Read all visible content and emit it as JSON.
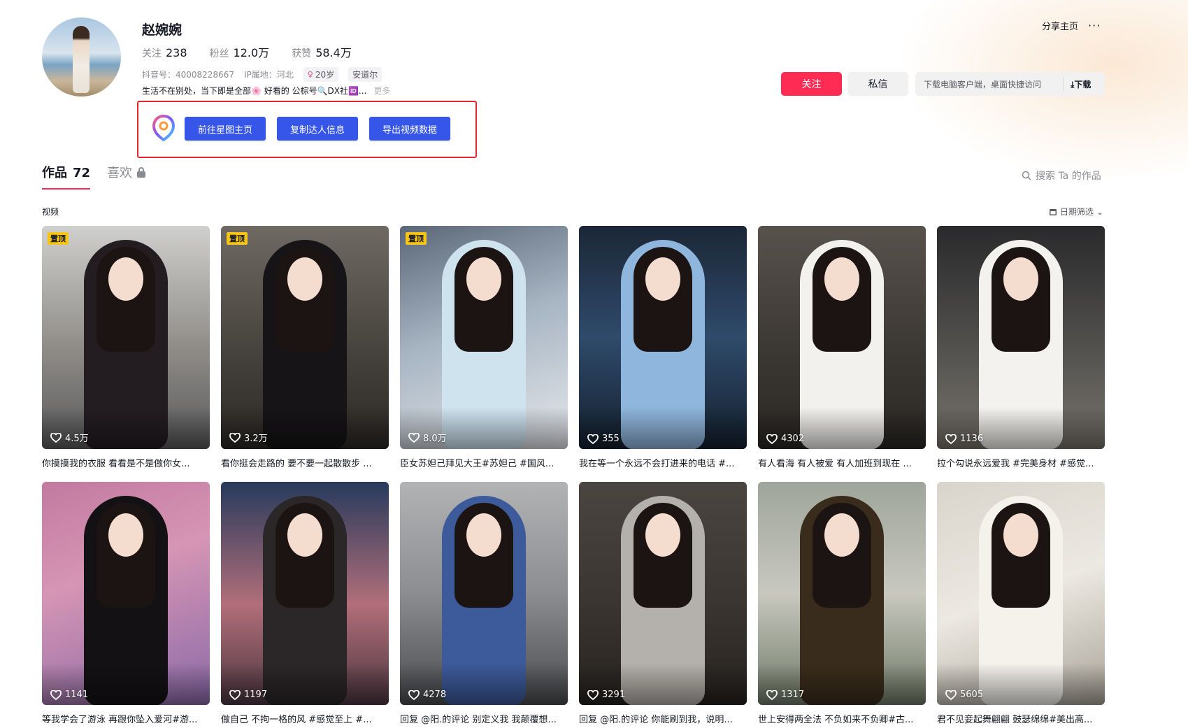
{
  "profile": {
    "name": "赵婉婉",
    "stats": [
      {
        "label": "关注",
        "value": "238"
      },
      {
        "label": "粉丝",
        "value": "12.0万"
      },
      {
        "label": "获赞",
        "value": "58.4万"
      }
    ],
    "douyin_id": "抖音号：40008228667",
    "ip": "IP属地：河北",
    "age": "20岁",
    "location": "安道尔",
    "bio": "生活不在别处，当下即是全部🌸 好看的 公棕号🔍DX社🆔...",
    "more": "更多"
  },
  "plugin": {
    "buttons": [
      "前往星图主页",
      "复制达人信息",
      "导出视频数据"
    ]
  },
  "actions": {
    "share": "分享主页",
    "more": "···",
    "follow": "关注",
    "message": "私信",
    "download_hint": "下载电脑客户端，桌面快捷访问",
    "download": "下载"
  },
  "tabs": {
    "works_label": "作品",
    "works_count": "72",
    "likes_label": "喜欢"
  },
  "search_placeholder": "搜索 Ta 的作品",
  "section_label": "视频",
  "date_filter": "日期筛选",
  "pinned_label": "置顶",
  "videos": [
    {
      "likes": "4.5万",
      "caption": "你摸摸我的衣服 看看是不是做你女...",
      "pinned": true
    },
    {
      "likes": "3.2万",
      "caption": "看你挺会走路的 要不要一起散散步 ...",
      "pinned": true
    },
    {
      "likes": "8.0万",
      "caption": "臣女苏妲己拜见大王#苏妲己 #国风...",
      "pinned": true
    },
    {
      "likes": "355",
      "caption": "我在等一个永远不会打进来的电话 #...",
      "pinned": false
    },
    {
      "likes": "4302",
      "caption": "有人看海 有人被爱 有人加班到现在 ...",
      "pinned": false
    },
    {
      "likes": "1136",
      "caption": "拉个勾说永远爱我 #完美身材 #感觉...",
      "pinned": false
    },
    {
      "likes": "1141",
      "caption": "等我学会了游泳 再跟你坠入爱河#游...",
      "pinned": false
    },
    {
      "likes": "1197",
      "caption": "做自己 不拘一格的风 #感觉至上 #...",
      "pinned": false
    },
    {
      "likes": "4278",
      "caption": "回复 @阳.的评论 别定义我 我颠覆想...",
      "pinned": false
    },
    {
      "likes": "3291",
      "caption": "回复 @阳.的评论 你能刷到我，说明...",
      "pinned": false
    },
    {
      "likes": "1317",
      "caption": "世上安得两全法 不负如来不负卿#古...",
      "pinned": false
    },
    {
      "likes": "5605",
      "caption": "君不见妾起舞翩翩 鼓瑟绵绵#美出高...",
      "pinned": false
    }
  ],
  "colors": {
    "follow_red": "#fe2c55",
    "plugin_blue": "#3655e9",
    "highlight_box": "#e8252f",
    "pinned_badge": "#f5c518"
  }
}
